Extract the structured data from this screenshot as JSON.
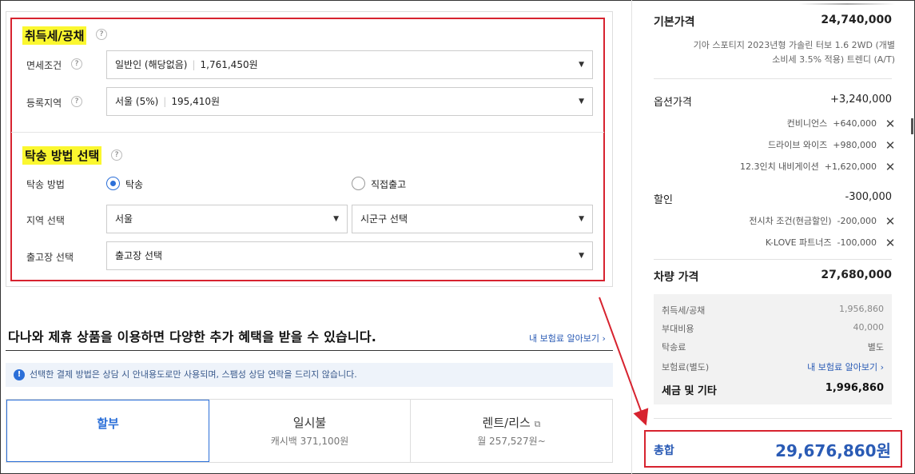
{
  "form": {
    "tax_section": {
      "title": "취득세/공채",
      "rows": [
        {
          "label": "면세조건",
          "value": "일반인 (해당없음)",
          "amount": "1,761,450원"
        },
        {
          "label": "등록지역",
          "value": "서울 (5%)",
          "amount": "195,410원"
        }
      ]
    },
    "delivery_section": {
      "title": "탁송 방법 선택",
      "method_label": "탁송 방법",
      "options": [
        {
          "label": "탁송",
          "selected": true
        },
        {
          "label": "직접출고",
          "selected": false
        }
      ],
      "region_label": "지역 선택",
      "region_value": "서울",
      "district_value": "시군구 선택",
      "depot_label": "출고장 선택",
      "depot_value": "출고장 선택"
    }
  },
  "promo": {
    "title": "다나와 제휴 상품을 이용하면 다양한 추가 혜택을 받을 수 있습니다.",
    "insurance_link": "내 보험료 알아보기 ›",
    "notice": "선택한 결제 방법은 상담 시 안내용도로만 사용되며, 스팸성 상담 연락을 드리지 않습니다.",
    "tabs": [
      {
        "label": "할부",
        "sub": "",
        "active": true
      },
      {
        "label": "일시불",
        "sub": "캐시백 371,100원",
        "active": false
      },
      {
        "label": "렌트/리스",
        "sub": "월 257,527원~",
        "active": false
      }
    ]
  },
  "summary": {
    "base_price_label": "기본가격",
    "base_price": "24,740,000",
    "model_desc_1": "기아 스포티지 2023년형 가솔린 터보 1.6 2WD (개별",
    "model_desc_2": "소비세 3.5% 적용) 트렌디 (A/T)",
    "options_label": "옵션가격",
    "options_total": "+3,240,000",
    "options": [
      {
        "name": "컨비니언스",
        "price": "+640,000"
      },
      {
        "name": "드라이브 와이즈",
        "price": "+980,000"
      },
      {
        "name": "12.3인치 내비게이션",
        "price": "+1,620,000"
      }
    ],
    "discount_label": "할인",
    "discount_total": "-300,000",
    "discounts": [
      {
        "name": "전시차 조건(현금할인)",
        "price": "-200,000"
      },
      {
        "name": "K-LOVE 파트너즈",
        "price": "-100,000"
      }
    ],
    "car_price_label": "차량 가격",
    "car_price": "27,680,000",
    "fees": [
      {
        "label": "취득세/공채",
        "value": "1,956,860"
      },
      {
        "label": "부대비용",
        "value": "40,000"
      },
      {
        "label": "탁송료",
        "value": "별도"
      },
      {
        "label": "보험료(별도)",
        "value": "내 보험료 알아보기 ›"
      }
    ],
    "tax_other_label": "세금 및 기타",
    "tax_other": "1,996,860",
    "total_label": "총합",
    "total": "29,676,860원"
  },
  "colors": {
    "accent": "#2b6fd8",
    "highlight_box": "#d7232f",
    "marker": "#fbf72f"
  }
}
